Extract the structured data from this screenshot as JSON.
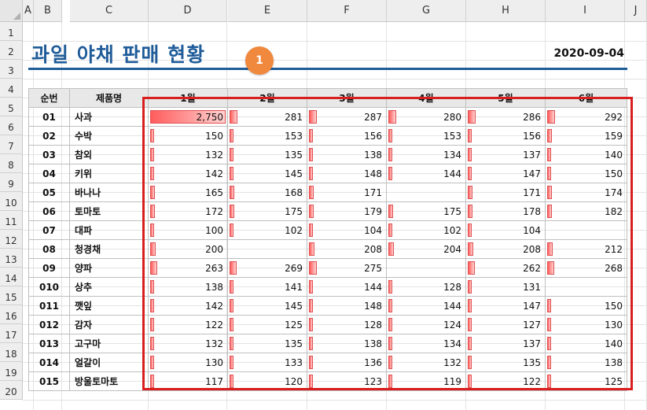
{
  "sheet": {
    "column_headers": [
      "A",
      "B",
      "C",
      "D",
      "E",
      "F",
      "G",
      "H",
      "I",
      "J"
    ],
    "row_headers": [
      "1",
      "2",
      "3",
      "4",
      "5",
      "6",
      "7",
      "8",
      "9",
      "10",
      "11",
      "12",
      "13",
      "14",
      "15",
      "16",
      "17",
      "18",
      "19",
      "20"
    ],
    "title": "과일 야채 판매 현황",
    "date": "2020-09-04",
    "marker_label": "1"
  },
  "table": {
    "headers": [
      "순번",
      "제품명",
      "1월",
      "2월",
      "3월",
      "4월",
      "5월",
      "6월"
    ],
    "max_value": 2750,
    "rows": [
      {
        "num": "01",
        "name": "사과",
        "values": [
          "2,750",
          "281",
          "287",
          "280",
          "286",
          "292"
        ],
        "raw": [
          2750,
          281,
          287,
          280,
          286,
          292
        ]
      },
      {
        "num": "02",
        "name": "수박",
        "values": [
          "150",
          "153",
          "156",
          "153",
          "156",
          "159"
        ],
        "raw": [
          150,
          153,
          156,
          153,
          156,
          159
        ]
      },
      {
        "num": "03",
        "name": "참외",
        "values": [
          "132",
          "135",
          "138",
          "134",
          "137",
          "140"
        ],
        "raw": [
          132,
          135,
          138,
          134,
          137,
          140
        ]
      },
      {
        "num": "04",
        "name": "키위",
        "values": [
          "142",
          "145",
          "148",
          "144",
          "147",
          "150"
        ],
        "raw": [
          142,
          145,
          148,
          144,
          147,
          150
        ]
      },
      {
        "num": "05",
        "name": "바나나",
        "values": [
          "165",
          "168",
          "171",
          "",
          "171",
          "174"
        ],
        "raw": [
          165,
          168,
          171,
          null,
          171,
          174
        ]
      },
      {
        "num": "06",
        "name": "토마토",
        "values": [
          "172",
          "175",
          "179",
          "175",
          "178",
          "182"
        ],
        "raw": [
          172,
          175,
          179,
          175,
          178,
          182
        ]
      },
      {
        "num": "07",
        "name": "대파",
        "values": [
          "100",
          "102",
          "104",
          "102",
          "104",
          ""
        ],
        "raw": [
          100,
          102,
          104,
          102,
          104,
          null
        ]
      },
      {
        "num": "08",
        "name": "청경채",
        "values": [
          "200",
          "",
          "208",
          "204",
          "208",
          "212"
        ],
        "raw": [
          200,
          null,
          208,
          204,
          208,
          212
        ]
      },
      {
        "num": "09",
        "name": "양파",
        "values": [
          "263",
          "269",
          "275",
          "",
          "262",
          "268"
        ],
        "raw": [
          263,
          269,
          275,
          null,
          262,
          268
        ]
      },
      {
        "num": "010",
        "name": "상추",
        "values": [
          "138",
          "141",
          "144",
          "128",
          "131",
          ""
        ],
        "raw": [
          138,
          141,
          144,
          128,
          131,
          null
        ]
      },
      {
        "num": "011",
        "name": "깻잎",
        "values": [
          "142",
          "145",
          "148",
          "144",
          "147",
          "150"
        ],
        "raw": [
          142,
          145,
          148,
          144,
          147,
          150
        ]
      },
      {
        "num": "012",
        "name": "감자",
        "values": [
          "122",
          "125",
          "128",
          "124",
          "127",
          "130"
        ],
        "raw": [
          122,
          125,
          128,
          124,
          127,
          130
        ]
      },
      {
        "num": "013",
        "name": "고구마",
        "values": [
          "132",
          "135",
          "138",
          "134",
          "137",
          "140"
        ],
        "raw": [
          132,
          135,
          138,
          134,
          137,
          140
        ]
      },
      {
        "num": "014",
        "name": "얼갈이",
        "values": [
          "130",
          "133",
          "136",
          "132",
          "135",
          "138"
        ],
        "raw": [
          130,
          133,
          136,
          132,
          135,
          138
        ]
      },
      {
        "num": "015",
        "name": "방울토마토",
        "values": [
          "117",
          "120",
          "123",
          "119",
          "122",
          "125"
        ],
        "raw": [
          117,
          120,
          123,
          119,
          122,
          125
        ]
      }
    ]
  },
  "colors": {
    "title": "#1f5c99",
    "highlight_box": "#d81e1e",
    "marker": "#f0883e",
    "data_bar": "#ff5c5c"
  }
}
